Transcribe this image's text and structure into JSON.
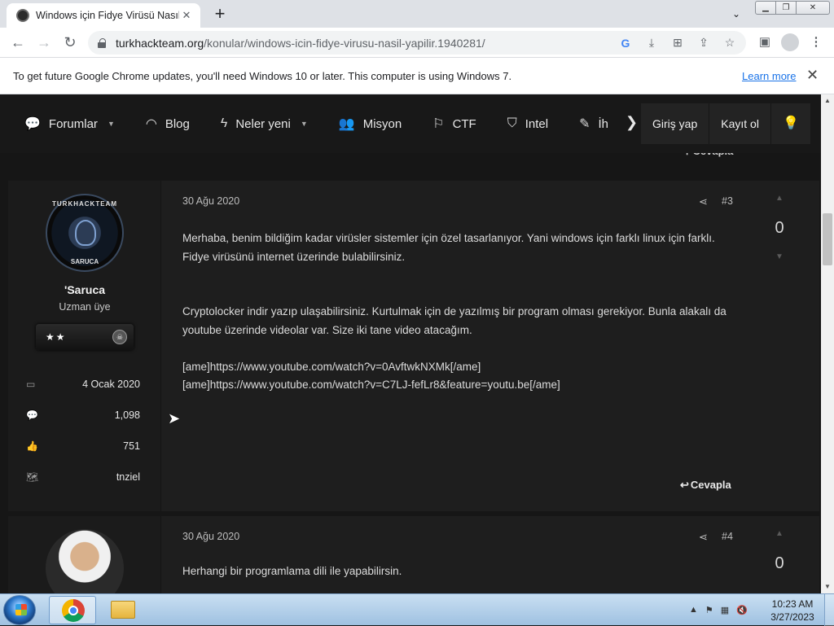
{
  "browser": {
    "tab_title": "Windows için Fidye Virüsü Nasıl yapılır",
    "new_tab": "+",
    "tab_search": "⌄",
    "url_host": "turkhackteam.org",
    "url_path": "/konular/windows-icin-fidye-virusu-nasil-yapilir.1940281/",
    "omni_icons": [
      "G",
      "⤓",
      "⊞",
      "⇪",
      "☆"
    ],
    "infobar_text": "To get future Google Chrome updates, you'll need Windows 10 or later. This computer is using Windows 7.",
    "infobar_link": "Learn more"
  },
  "site_nav": {
    "items": [
      {
        "label": "Forumlar",
        "icon": "chat-bubble-icon",
        "glyph": "💬",
        "dropdown": true
      },
      {
        "label": "Blog",
        "icon": "rss-icon",
        "glyph": "◠",
        "dropdown": false
      },
      {
        "label": "Neler yeni",
        "icon": "bolt-icon",
        "glyph": "ϟ",
        "dropdown": true
      },
      {
        "label": "Misyon",
        "icon": "users-icon",
        "glyph": "👥",
        "dropdown": false
      },
      {
        "label": "CTF",
        "icon": "flag-icon",
        "glyph": "⚐",
        "dropdown": false
      },
      {
        "label": "Intel",
        "icon": "shield-icon",
        "glyph": "⛉",
        "dropdown": false
      },
      {
        "label": "İh",
        "icon": "pencil-icon",
        "glyph": "✎",
        "dropdown": false
      }
    ],
    "login": "Giriş yap",
    "register": "Kayıt ol",
    "prev_reply": "↰ Cevapla"
  },
  "posts": [
    {
      "date": "30 Ağu 2020",
      "number": "#3",
      "score": "0",
      "user": {
        "name": "'Saruca",
        "title": "Uzman üye",
        "avatar_top": "TURKHACKTEAM",
        "avatar_bottom": "SARUCA",
        "rank_stars": "★★",
        "stats": [
          {
            "icon": "calendar-icon",
            "glyph": "▭",
            "value": "4 Ocak 2020"
          },
          {
            "icon": "messages-icon",
            "glyph": "💬",
            "value": "1,098"
          },
          {
            "icon": "thumbs-up-icon",
            "glyph": "👍",
            "value": "751"
          },
          {
            "icon": "map-icon",
            "glyph": "🗺",
            "value": "tnziel"
          }
        ]
      },
      "paragraphs": [
        "Merhaba, benim bildiğim kadar virüsler sistemler için özel tasarlanıyor. Yani windows için farklı linux için farklı. Fidye virüsünü internet üzerinde bulabilirsiniz.",
        "Cryptolocker indir yazıp ulaşabilirsiniz. Kurtulmak için de yazılmış bir program olması gerekiyor. Bunla alakalı da youtube üzerinde videolar var. Size iki tane video atacağım.",
        "[ame]https://www.youtube.com/watch?v=0AvftwkNXMk[/ame]",
        "[ame]https://www.youtube.com/watch?v=C7LJ-fefLr8&feature=youtu.be[/ame]"
      ],
      "reply": "Cevapla"
    },
    {
      "date": "30 Ağu 2020",
      "number": "#4",
      "score": "0",
      "paragraphs": [
        "Herhangi bir programlama dili ile yapabilirsin."
      ]
    }
  ],
  "taskbar": {
    "time": "10:23 AM",
    "date": "3/27/2023"
  }
}
